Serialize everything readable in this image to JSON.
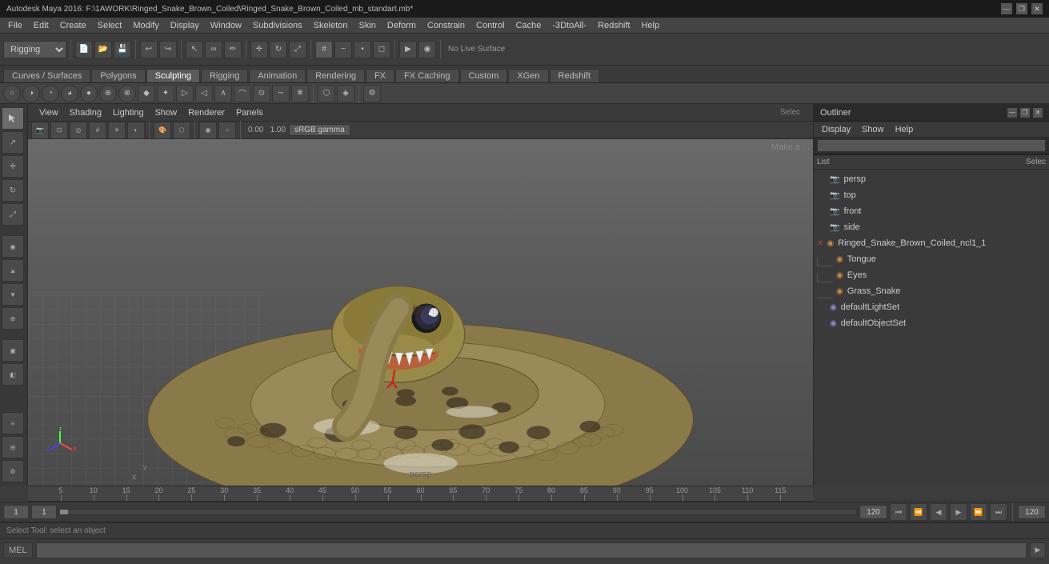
{
  "window": {
    "title": "Autodesk Maya 2016: F:\\1AWORK\\Ringed_Snake_Brown_Coiled\\Ringed_Snake_Brown_Coiled_mb_standart.mb*",
    "controls": [
      "—",
      "❐",
      "✕"
    ]
  },
  "menubar": {
    "items": [
      "File",
      "Edit",
      "Create",
      "Select",
      "Modify",
      "Display",
      "Window",
      "Subdivisions",
      "Skeleton",
      "Skin",
      "Deform",
      "Constrain",
      "Control",
      "Cache",
      "-3DtoAll-",
      "Redshift",
      "Help"
    ]
  },
  "workspace_selector": {
    "label": "Rigging",
    "value": "Rigging"
  },
  "mode_tabs": {
    "items": [
      "Curves / Surfaces",
      "Polygons",
      "Sculpting",
      "Rigging",
      "Animation",
      "Rendering",
      "FX",
      "FX Caching",
      "Custom",
      "XGen",
      "Redshift"
    ],
    "active": "Sculpting"
  },
  "viewport_menu": {
    "items": [
      "View",
      "Shading",
      "Lighting",
      "Show",
      "Renderer",
      "Panels"
    ]
  },
  "viewport": {
    "label": "persp",
    "select_label": "Selec",
    "gamma": "sRGB gamma",
    "value": "0.00",
    "multiplier": "1.00",
    "make_a_label": "Make a ...",
    "no_live_surface": "No Live Surface"
  },
  "outliner": {
    "title": "Outliner",
    "menu_items": [
      "Display",
      "Show",
      "Help"
    ],
    "search_placeholder": "",
    "header_cols": [
      "List",
      "Selec"
    ],
    "tree": [
      {
        "id": "persp",
        "label": "persp",
        "type": "camera",
        "level": 0,
        "icon": "📷"
      },
      {
        "id": "top",
        "label": "top",
        "type": "camera",
        "level": 0,
        "icon": "📷"
      },
      {
        "id": "front",
        "label": "front",
        "type": "camera",
        "level": 0,
        "icon": "📷"
      },
      {
        "id": "side",
        "label": "side",
        "type": "camera",
        "level": 0,
        "icon": "📷"
      },
      {
        "id": "ringed_snake",
        "label": "Ringed_Snake_Brown_Coiled_ncl1_1",
        "type": "group",
        "level": 0,
        "expanded": true,
        "icon": "▼"
      },
      {
        "id": "tongue",
        "label": "Tongue",
        "type": "mesh",
        "level": 1,
        "icon": "⬡"
      },
      {
        "id": "eyes",
        "label": "Eyes",
        "type": "mesh",
        "level": 1,
        "icon": "⬡"
      },
      {
        "id": "grass_snake",
        "label": "Grass_Snake",
        "type": "mesh",
        "level": 1,
        "icon": "⬡"
      },
      {
        "id": "defaultLightSet",
        "label": "defaultLightSet",
        "type": "set",
        "level": 0,
        "icon": "◉"
      },
      {
        "id": "defaultObjectSet",
        "label": "defaultObjectSet",
        "type": "set",
        "level": 0,
        "icon": "◉"
      }
    ]
  },
  "timeline": {
    "start_frame": "1",
    "current_frame": "1",
    "end_frame": "120",
    "playback_end": "120",
    "range_start": "1",
    "range_end": "120",
    "ticks": [
      {
        "pos": 5,
        "label": "5"
      },
      {
        "pos": 10,
        "label": "10"
      },
      {
        "pos": 15,
        "label": "15"
      },
      {
        "pos": 20,
        "label": "20"
      },
      {
        "pos": 25,
        "label": "25"
      },
      {
        "pos": 30,
        "label": "30"
      },
      {
        "pos": 35,
        "label": "35"
      },
      {
        "pos": 40,
        "label": "40"
      },
      {
        "pos": 45,
        "label": "45"
      },
      {
        "pos": 50,
        "label": "50"
      },
      {
        "pos": 55,
        "label": "55"
      },
      {
        "pos": 60,
        "label": "60"
      },
      {
        "pos": 65,
        "label": "65"
      },
      {
        "pos": 70,
        "label": "70"
      },
      {
        "pos": 75,
        "label": "75"
      },
      {
        "pos": 80,
        "label": "80"
      },
      {
        "pos": 85,
        "label": "85"
      },
      {
        "pos": 90,
        "label": "90"
      },
      {
        "pos": 95,
        "label": "95"
      },
      {
        "pos": 100,
        "label": "100"
      },
      {
        "pos": 105,
        "label": "105"
      },
      {
        "pos": 110,
        "label": "110"
      },
      {
        "pos": 115,
        "label": "115"
      }
    ]
  },
  "mel_bar": {
    "label": "MEL",
    "status": "Select Tool: select an object"
  },
  "icons": {
    "sculpt_tools": [
      "⊙",
      "⊕",
      "⊗",
      "◑",
      "◔",
      "◕",
      "✦",
      "◆",
      "⬡",
      "◈",
      "⬟",
      "▣",
      "▤",
      "◧",
      "◩",
      "⬜",
      "⬛",
      "⊞",
      "⊟",
      "⊠",
      "⊡",
      "▦",
      "▩",
      "▨",
      "▧",
      "◰",
      "◱",
      "◲",
      "◳"
    ]
  }
}
